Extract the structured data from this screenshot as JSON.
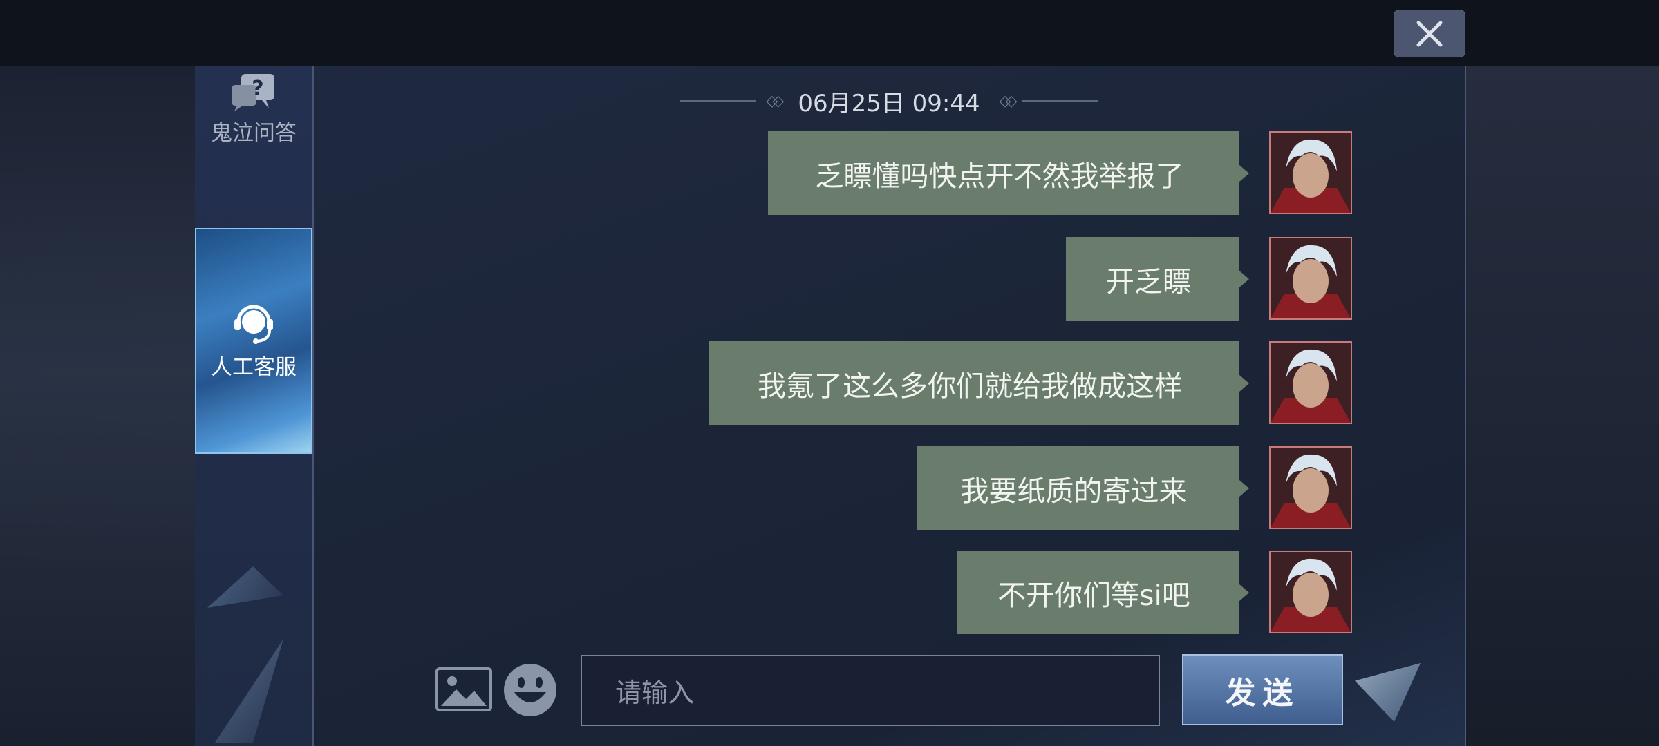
{
  "window": {
    "close_icon": "close-x-icon"
  },
  "sidebar": {
    "items": [
      {
        "label": "鬼泣问答",
        "icon": "question-bubble-icon",
        "active": false
      },
      {
        "label": "人工客服",
        "icon": "headset-agent-icon",
        "active": true
      }
    ]
  },
  "chat": {
    "timestamp": "06月25日 09:44",
    "messages": [
      {
        "text": "乏瞟懂吗快点开不然我举报了"
      },
      {
        "text": "开乏瞟"
      },
      {
        "text": "我氪了这么多你们就给我做成这样"
      },
      {
        "text": "我要纸质的寄过来"
      },
      {
        "text": "不开你们等si吧"
      }
    ]
  },
  "composer": {
    "image_icon": "image-icon",
    "emoji_icon": "smiley-emoji-icon",
    "placeholder": "请输入",
    "send_label": "发送"
  },
  "colors": {
    "bubble": "#6a7d6d",
    "panel": "#1f2940",
    "accent": "#3b7fc0"
  }
}
